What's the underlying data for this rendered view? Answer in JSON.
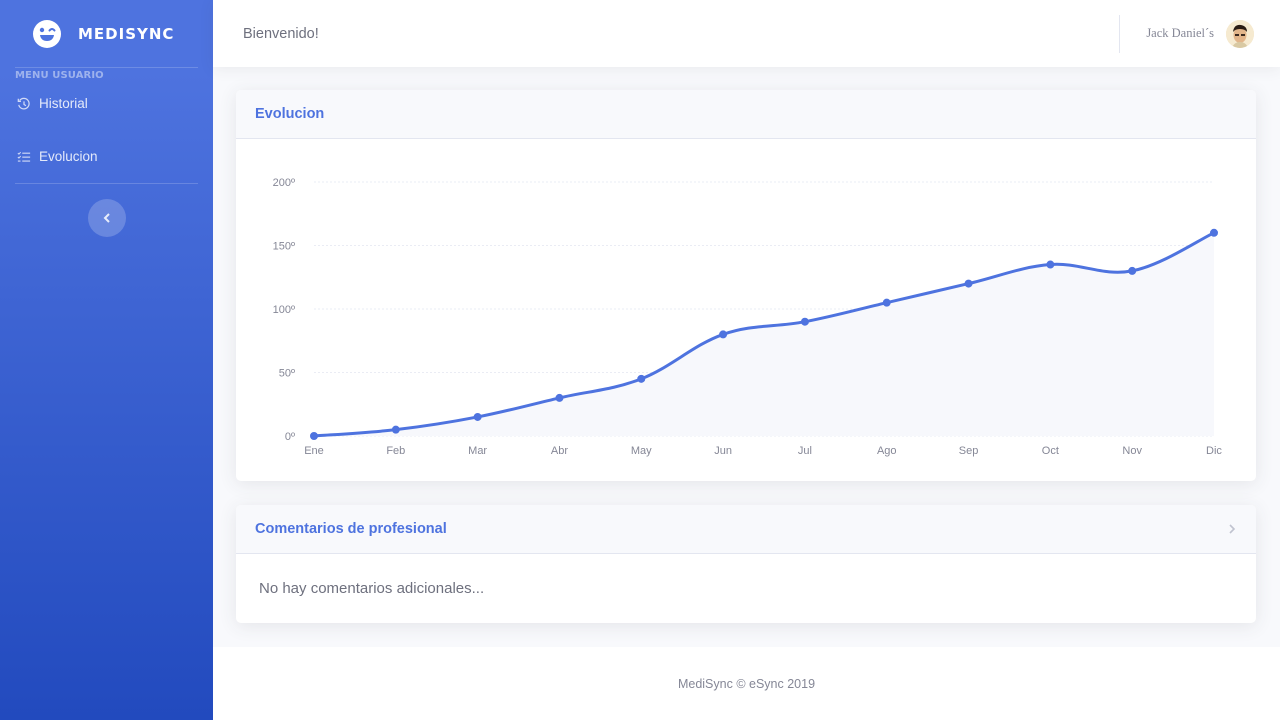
{
  "brand": {
    "name": "MEDISYNC"
  },
  "sidebar": {
    "heading": "MENU USUARIO",
    "items": [
      {
        "label": "Historial",
        "icon": "history-icon"
      },
      {
        "label": "Evolucion",
        "icon": "list-check-icon"
      }
    ],
    "toggle_icon": "chevron-left-icon"
  },
  "topbar": {
    "welcome": "Bienvenido!",
    "username": "Jack Daniel´s"
  },
  "chart_card": {
    "title": "Evolucion"
  },
  "chart_data": {
    "type": "area",
    "categories": [
      "Ene",
      "Feb",
      "Mar",
      "Abr",
      "May",
      "Jun",
      "Jul",
      "Ago",
      "Sep",
      "Oct",
      "Nov",
      "Dic"
    ],
    "values": [
      0,
      5,
      15,
      30,
      45,
      80,
      90,
      105,
      120,
      135,
      130,
      160
    ],
    "ylim": [
      0,
      200
    ],
    "yticks": [
      0,
      50,
      100,
      150,
      200
    ],
    "ytick_labels": [
      "0º",
      "50º",
      "100º",
      "150º",
      "200º"
    ],
    "grid": true,
    "color": "#4e73df",
    "fill": "#f7f8fc"
  },
  "comments_card": {
    "title": "Comentarios de profesional",
    "body": "No hay comentarios adicionales..."
  },
  "footer": {
    "text": "MediSync © eSync 2019"
  },
  "colors": {
    "primary": "#4e73df",
    "sidebar_end": "#224abe"
  }
}
